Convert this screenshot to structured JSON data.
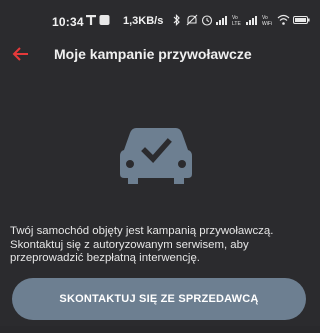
{
  "status_bar": {
    "time": "10:34",
    "network_speed": "1,3KB/s",
    "battery_level": "full"
  },
  "header": {
    "title": "Moje kampanie przywoławcze",
    "back_icon": "arrow-left-icon",
    "accent_color": "#e5393a"
  },
  "content": {
    "illustration": "car-check-icon",
    "illustration_color": "#6d7f91",
    "message": "Twój samochód objęty jest kampanią przywoławczą. Skontaktuj się z autoryzowanym serwisem, aby przeprowadzić bezpłatną interwencję."
  },
  "actions": {
    "contact_dealer_label": "SKONTAKTUJ SIĘ ZE SPRZEDAWCĄ",
    "button_color": "#6d7f91"
  }
}
